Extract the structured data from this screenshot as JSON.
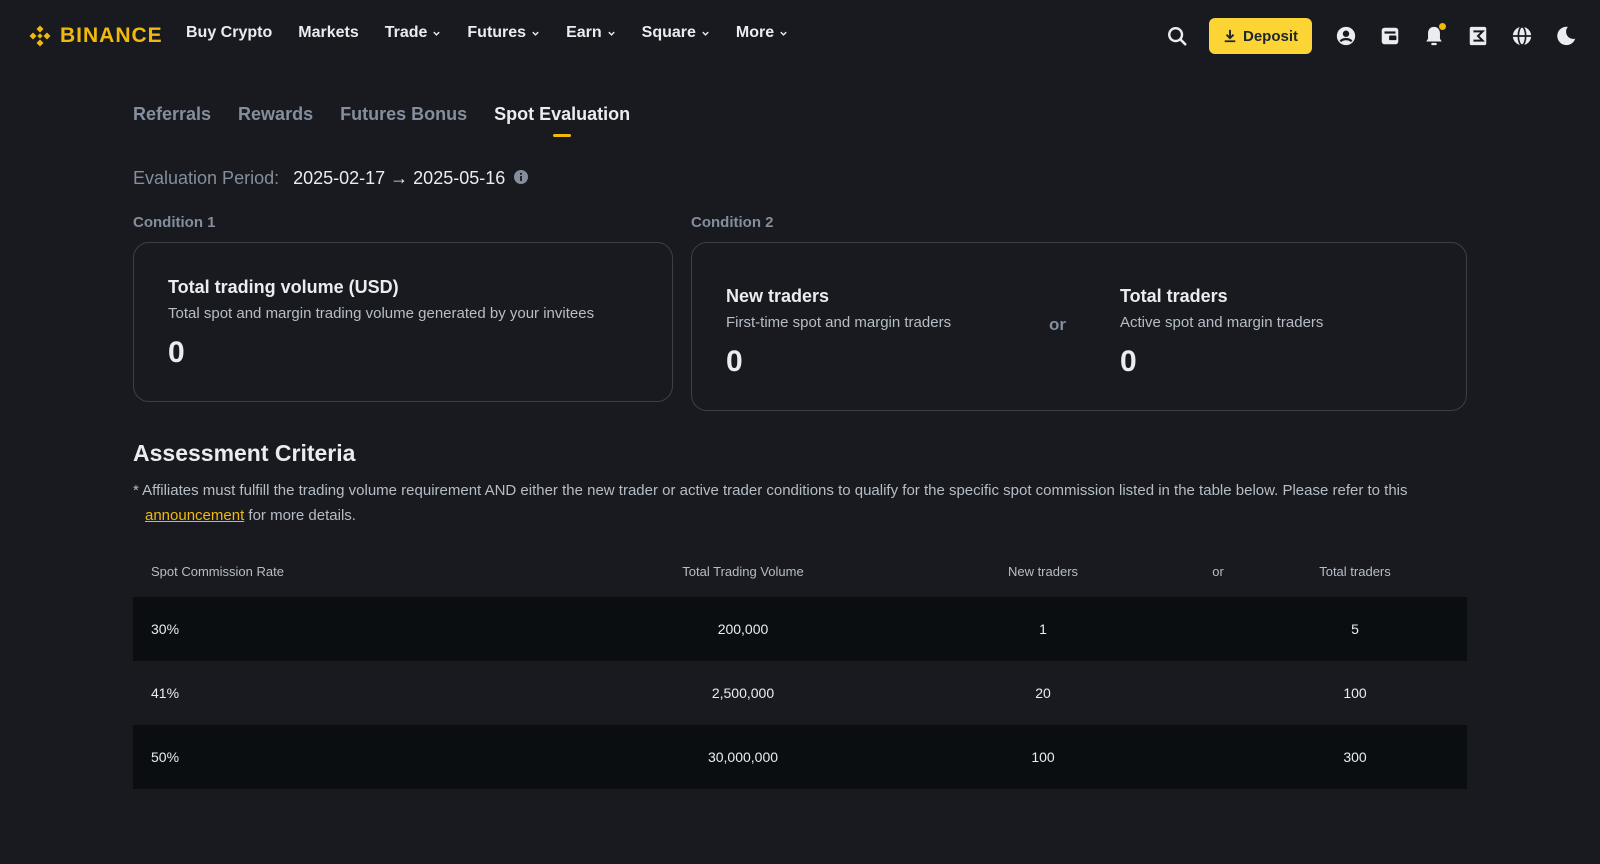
{
  "brand": {
    "name": "BINANCE",
    "accent": "#f0b90b",
    "button_bg": "#fcd535",
    "background": "#181a20"
  },
  "nav": {
    "items": [
      {
        "label": "Buy Crypto",
        "dropdown": false
      },
      {
        "label": "Markets",
        "dropdown": false
      },
      {
        "label": "Trade",
        "dropdown": true
      },
      {
        "label": "Futures",
        "dropdown": true
      },
      {
        "label": "Earn",
        "dropdown": true
      },
      {
        "label": "Square",
        "dropdown": true
      },
      {
        "label": "More",
        "dropdown": true
      }
    ],
    "deposit_label": "Deposit",
    "icons": [
      "search-icon",
      "download-icon",
      "user-icon",
      "wallet-icon",
      "bell-icon",
      "orders-icon",
      "globe-icon",
      "moon-icon"
    ]
  },
  "tabs": [
    {
      "label": "Referrals",
      "active": false
    },
    {
      "label": "Rewards",
      "active": false
    },
    {
      "label": "Futures Bonus",
      "active": false
    },
    {
      "label": "Spot Evaluation",
      "active": true
    }
  ],
  "evaluation": {
    "label": "Evaluation Period:",
    "value": "2025-02-17 → 2025-05-16"
  },
  "condition1": {
    "label": "Condition 1",
    "title": "Total trading volume (USD)",
    "subtitle": "Total spot and margin trading volume generated by your invitees",
    "value": "0"
  },
  "condition2": {
    "label": "Condition 2",
    "or_label": "or",
    "new_traders": {
      "title": "New traders",
      "subtitle": "First-time spot and margin traders",
      "value": "0"
    },
    "total_traders": {
      "title": "Total traders",
      "subtitle": "Active spot and margin traders",
      "value": "0"
    }
  },
  "assessment": {
    "title": "Assessment Criteria",
    "note_prefix": "* Affiliates must fulfill the trading volume requirement AND either the new trader or active trader conditions to qualify for the specific spot commission listed in the table below. Please refer to this ",
    "link_text": "announcement",
    "note_suffix": " for more details."
  },
  "table": {
    "headers": [
      "Spot Commission Rate",
      "Total Trading Volume",
      "New traders",
      "or",
      "Total traders"
    ],
    "rows": [
      [
        "30%",
        "200,000",
        "1",
        "",
        "5"
      ],
      [
        "41%",
        "2,500,000",
        "20",
        "",
        "100"
      ],
      [
        "50%",
        "30,000,000",
        "100",
        "",
        "300"
      ]
    ]
  }
}
